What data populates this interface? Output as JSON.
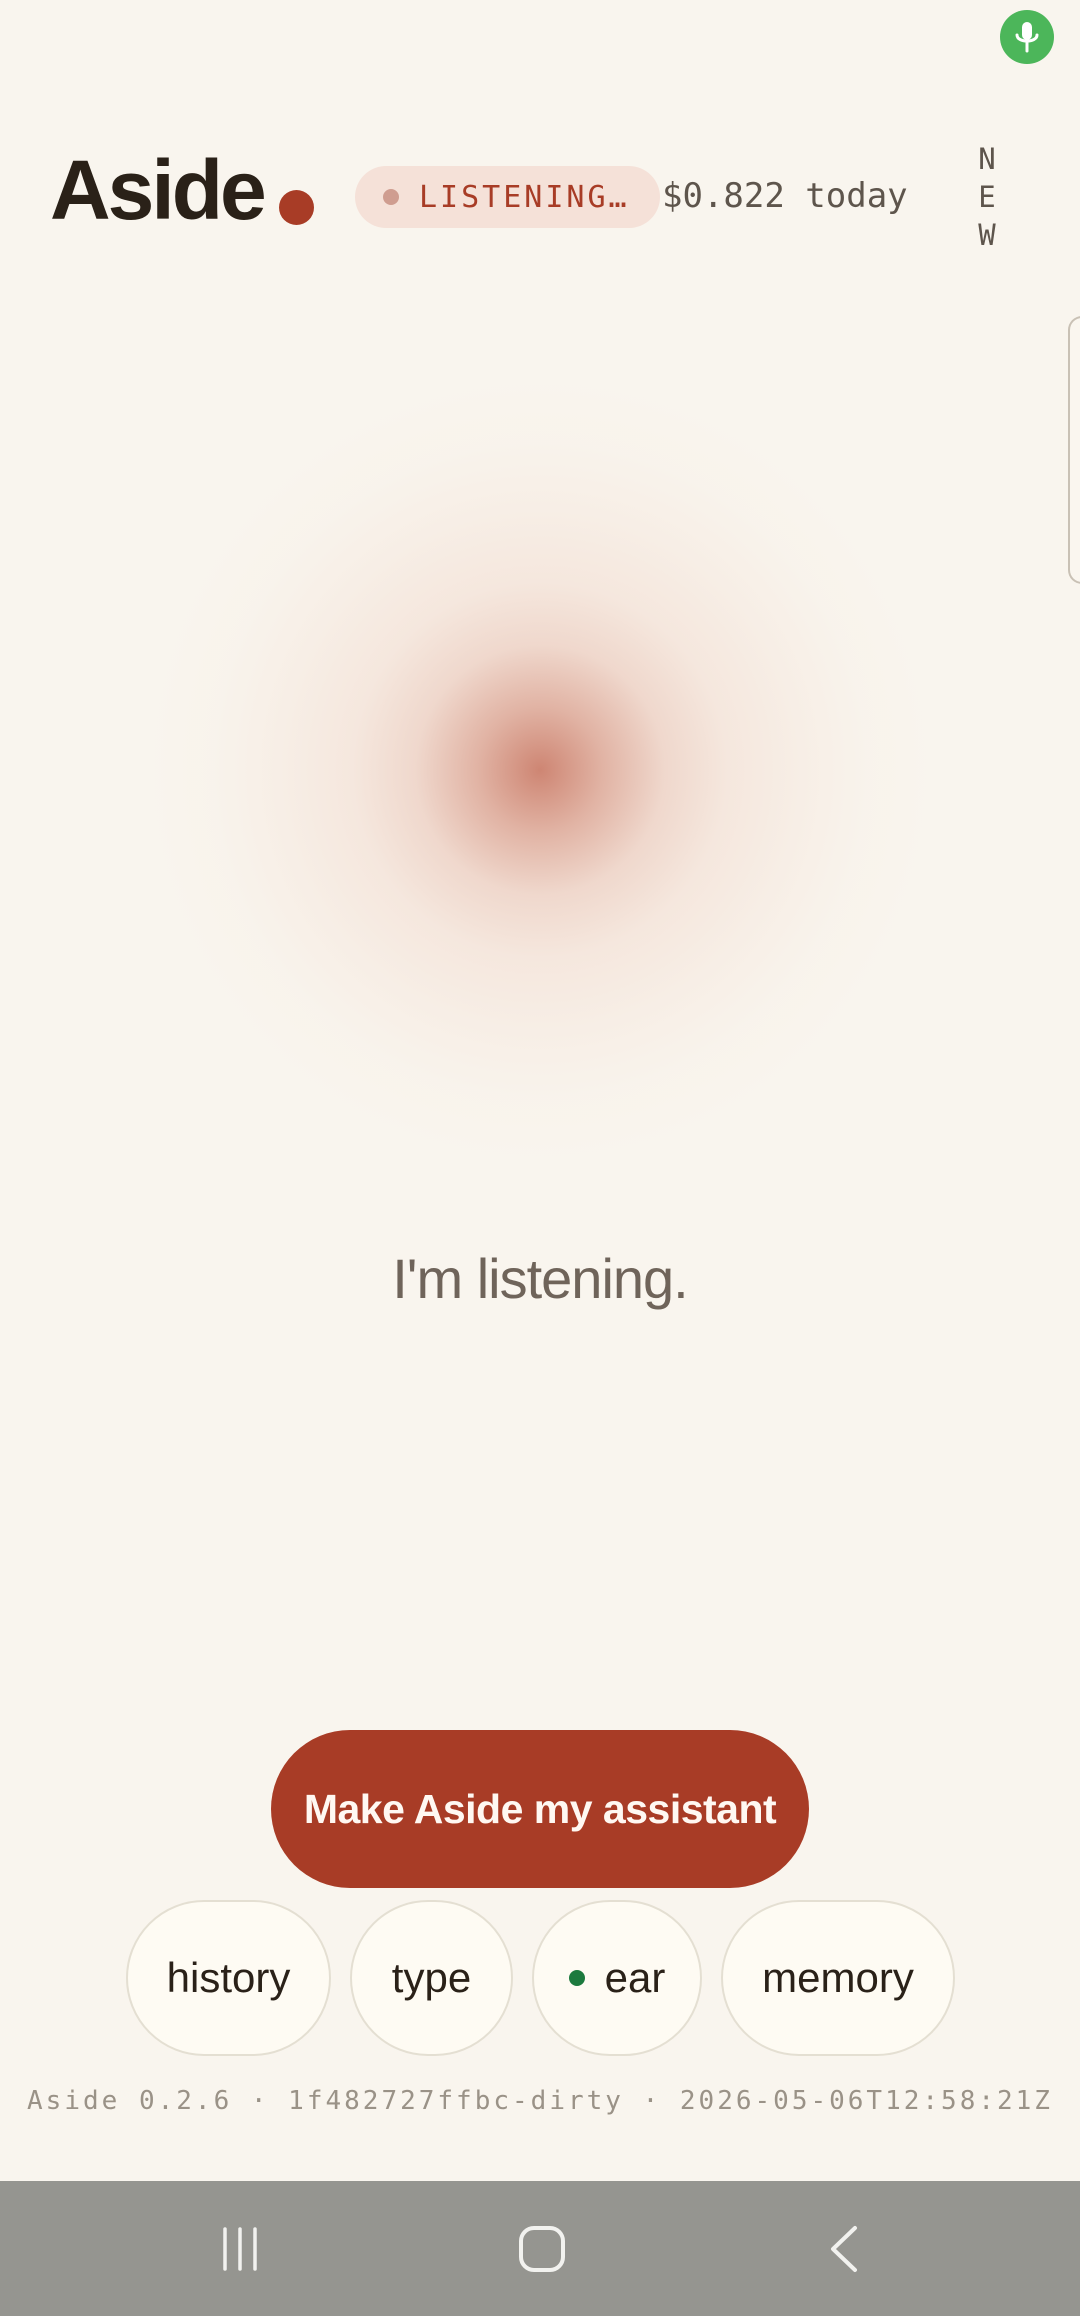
{
  "header": {
    "title": "Aside",
    "status_label": "LISTENING…",
    "cost_today": "$0.822 today",
    "new_label": "NEW"
  },
  "main": {
    "caption": "I'm listening."
  },
  "actions": {
    "primary_label": "Make Aside my assistant",
    "chips": {
      "history": "history",
      "type": "type",
      "ear": "ear",
      "memory": "memory"
    }
  },
  "footer": {
    "build_info": "Aside 0.2.6 · 1f482727ffbc-dirty · 2026-05-06T12:58:21Z"
  },
  "colors": {
    "accent": "#a83c26",
    "background": "#f9f5ee",
    "mic_indicator": "#4cb65a",
    "ear_active": "#1c7a3e"
  },
  "icons": {
    "mic_indicator": "microphone-icon",
    "nav_recents": "recents-icon",
    "nav_home": "home-icon",
    "nav_back": "back-icon"
  }
}
